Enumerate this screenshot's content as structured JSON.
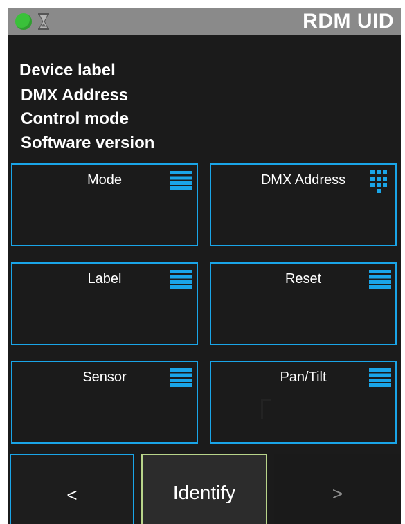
{
  "status_bar": {
    "title": "RDM UID",
    "status_color": "#3ac13a",
    "status_icon": "status-indicator-icon",
    "busy_icon": "hourglass-icon"
  },
  "device_info": {
    "lines": [
      "Device label",
      "DMX Address",
      "Control mode",
      "Software version"
    ]
  },
  "tiles": [
    {
      "label": "Mode",
      "icon": "menu-icon"
    },
    {
      "label": "DMX Address",
      "icon": "keypad-icon"
    },
    {
      "label": "Label",
      "icon": "menu-icon"
    },
    {
      "label": "Reset",
      "icon": "menu-icon"
    },
    {
      "label": "Sensor",
      "icon": "menu-icon"
    },
    {
      "label": "Pan/Tilt",
      "icon": "menu-icon"
    }
  ],
  "bottom_bar": {
    "prev_label": "<",
    "identify_label": "Identify",
    "next_label": ">"
  },
  "colors": {
    "accent": "#1aa5e8",
    "identify_border": "#b8d48a",
    "disabled_text": "#8c8c8c"
  }
}
